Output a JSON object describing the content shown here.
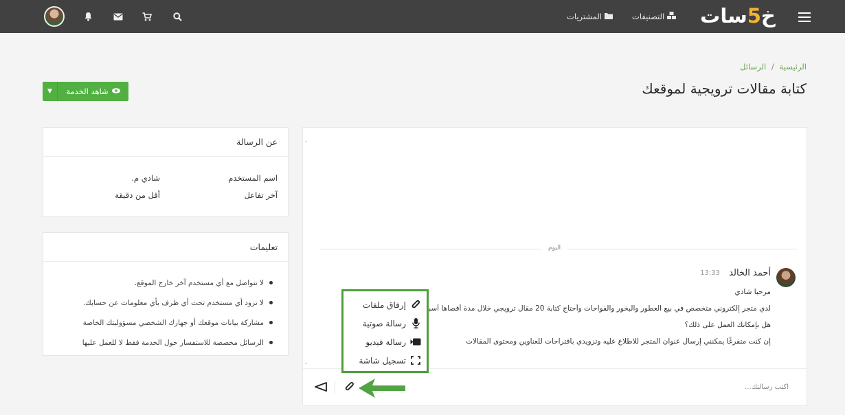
{
  "topbar": {
    "logo_prefix": "خ",
    "logo_five": "5",
    "logo_suffix": "سات",
    "nav_categories": "التصنيفات",
    "nav_purchases": "المشتريات"
  },
  "breadcrumb": {
    "home": "الرئيسية",
    "separator": "/",
    "current": "الرسائل"
  },
  "page_title": "كتابة مقالات ترويجية لموقعك",
  "view_service_button": "شاهد الخدمة",
  "about_panel": {
    "title": "عن الرسالة",
    "rows": [
      {
        "label": "اسم المستخدم",
        "value": "شادي م."
      },
      {
        "label": "آخر تفاعل",
        "value": "أقل من دقيقة"
      }
    ]
  },
  "rules_panel": {
    "title": "تعليمات",
    "items": [
      "لا تتواصل مع أي مستخدم آخر خارج الموقع.",
      "لا تزود أي مستخدم تحت أي ظرف بأي معلومات عن حسابك.",
      "مشاركة بيانات موقعك أو جهازك الشخصي مسؤوليتك الخاصة",
      "الرسائل مخصصة للاستفسار حول الخدمة فقط لا للعمل عليها"
    ]
  },
  "chat": {
    "day_label": "اليوم",
    "message": {
      "sender": "أحمد الخالد",
      "time": "13:33",
      "lines": [
        "مرحبا شادي",
        "لدي متجر إلكتروني متخصص في بيع العطور والبخور والفواحات وأحتاج كتابة 20 مقال ترويجي خلال مدة أقصاها أسبوع",
        "هل بإمكانك العمل على ذلك؟",
        "إن كنت متفرغًا يمكنني إرسال عنوان المتجر للاطلاع عليه وتزويدي باقتراحات للعناوين ومحتوى المقالات"
      ]
    },
    "composer_placeholder": "اكتب رسالتك..."
  },
  "attach_menu": {
    "items": [
      {
        "label": "إرفاق ملفات",
        "icon": "paperclip-icon"
      },
      {
        "label": "رسالة صوتية",
        "icon": "microphone-icon"
      },
      {
        "label": "رسالة فيديو",
        "icon": "video-camera-icon"
      },
      {
        "label": "تسجيل شاشة",
        "icon": "screen-record-icon"
      }
    ]
  },
  "colors": {
    "brand_green": "#52b043",
    "topbar": "#414141",
    "logo_accent": "#f2b233"
  }
}
